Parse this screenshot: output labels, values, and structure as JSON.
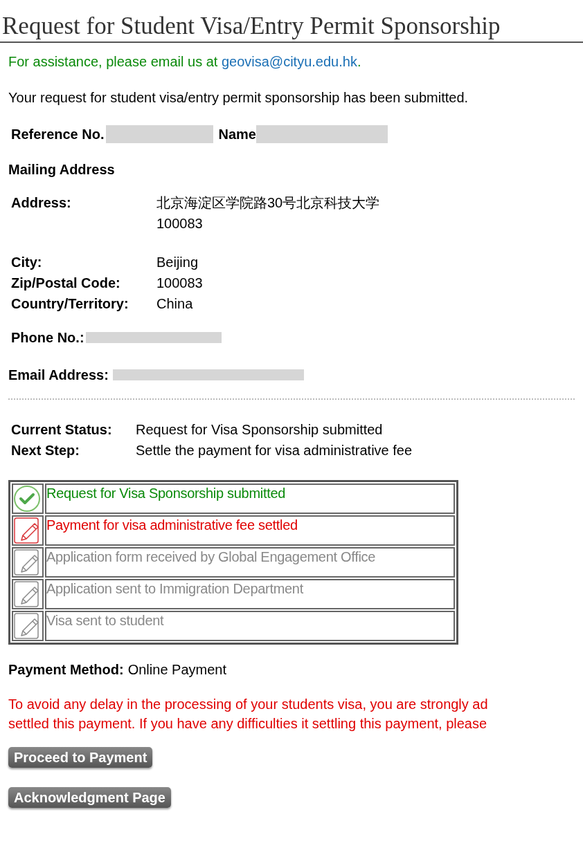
{
  "title": "Request for Student Visa/Entry Permit Sponsorship",
  "assistance": {
    "text": "For assistance, please email us at ",
    "email": "geovisa@cityu.edu.hk",
    "end": "."
  },
  "submitted_message": "Your request for student visa/entry permit sponsorship has been submitted.",
  "reference": {
    "label": "Reference No.",
    "name_label": "Name"
  },
  "mailing_heading": "Mailing Address",
  "address": {
    "label": "Address:",
    "lines": [
      "北京海淀区学院路30号北京科技大学",
      "100083"
    ]
  },
  "fields": [
    {
      "label": "City:",
      "value": "Beijing"
    },
    {
      "label": "Zip/Postal Code:",
      "value": "100083"
    },
    {
      "label": "Country/Territory:",
      "value": "China"
    }
  ],
  "phone_label": "Phone No.:",
  "email_label": "Email Address:",
  "status": [
    {
      "label": "Current Status:",
      "value": "Request for Visa Sponsorship submitted"
    },
    {
      "label": "Next Step:",
      "value": "Settle the payment for visa administrative fee"
    }
  ],
  "steps": [
    {
      "kind": "done",
      "text": "Request for Visa Sponsorship submitted"
    },
    {
      "kind": "current",
      "text": "Payment for visa administrative fee settled"
    },
    {
      "kind": "pending",
      "text": "Application form received by Global Engagement Office"
    },
    {
      "kind": "pending",
      "text": "Application sent to Immigration Department"
    },
    {
      "kind": "pending",
      "text": "Visa sent to student"
    }
  ],
  "payment_method": {
    "label": "Payment Method:",
    "value": "Online Payment"
  },
  "warning_lines": [
    "To avoid any delay in the processing of your students visa, you are strongly ad",
    "settled this payment. If you have any difficulties it settling this payment, please"
  ],
  "buttons": [
    "Proceed to Payment",
    "Acknowledgment Page"
  ]
}
